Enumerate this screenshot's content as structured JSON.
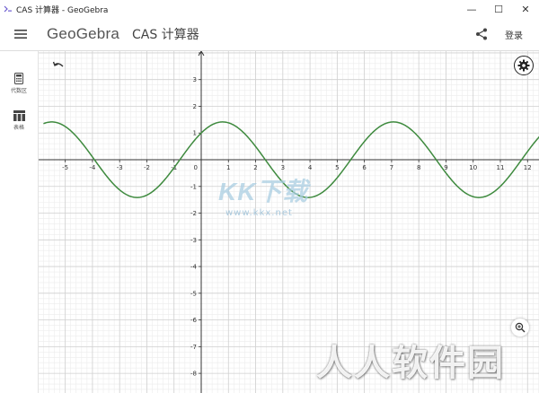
{
  "window": {
    "title": "CAS 计算器 - GeoGebra",
    "controls": [
      "—",
      "☐",
      "✕"
    ]
  },
  "header": {
    "logo": "GeoGebra",
    "app_title": "CAS 计算器",
    "login_label": "登录"
  },
  "sidebar": {
    "items": [
      {
        "label": "代数区",
        "icon": "calculator-icon"
      },
      {
        "label": "表格",
        "icon": "table-icon"
      }
    ]
  },
  "graph": {
    "x_ticks": [
      "-5",
      "-4",
      "-3",
      "-2",
      "-1",
      "0",
      "1",
      "2",
      "3",
      "4",
      "5",
      "6",
      "7",
      "8",
      "9",
      "10",
      "11",
      "12"
    ],
    "y_ticks": [
      "3",
      "2",
      "1",
      "-1",
      "-2",
      "-3",
      "-4",
      "-5",
      "-6",
      "-7",
      "-8"
    ],
    "curve_color": "#3E8A3E"
  },
  "chart_data": {
    "type": "line",
    "function": "sin(x) + cos(x)",
    "amplitude": 1.414,
    "period": 6.283,
    "xlim": [
      -5.8,
      12.6
    ],
    "ylim": [
      -8.6,
      4.2
    ],
    "grid": true,
    "series": [
      {
        "color": "#3E8A3E"
      }
    ]
  },
  "watermarks": {
    "center_text": "KK下载",
    "center_url": "www.kkx.net",
    "bottom_text": "人人软件园"
  }
}
